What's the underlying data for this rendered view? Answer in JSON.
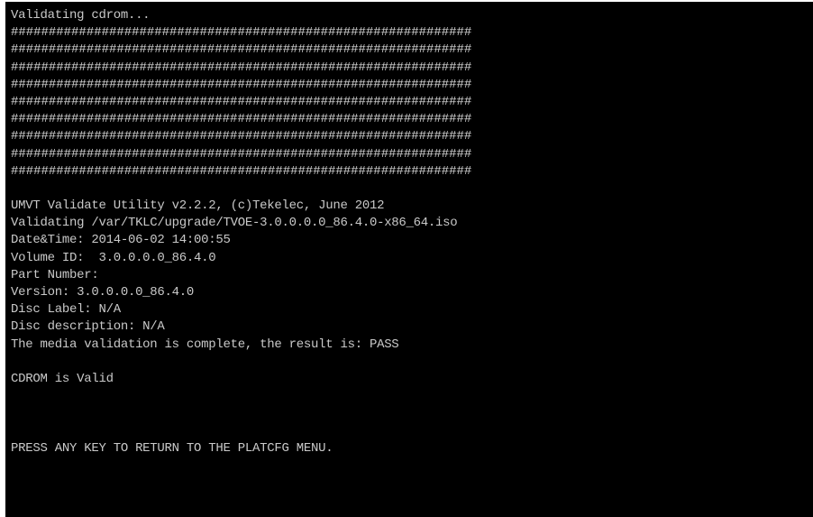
{
  "terminal": {
    "background": "#000000",
    "text_color": "#c9c9c9",
    "header": "Validating cdrom...",
    "progress_rows": [
      "#############################################################",
      "#############################################################",
      "#############################################################",
      "#############################################################",
      "#############################################################",
      "#############################################################",
      "#############################################################",
      "#############################################################",
      "#############################################################"
    ],
    "utility_line": "UMVT Validate Utility v2.2.2, (c)Tekelec, June 2012",
    "validating_line": "Validating /var/TKLC/upgrade/TVOE-3.0.0.0.0_86.4.0-x86_64.iso",
    "datetime_line": "Date&Time: 2014-06-02 14:00:55",
    "volume_id_line": "Volume ID:  3.0.0.0.0_86.4.0",
    "part_number_line": "Part Number:",
    "version_line": "Version: 3.0.0.0.0_86.4.0",
    "disc_label_line": "Disc Label: N/A",
    "disc_description_line": "Disc description: N/A",
    "result_line": "The media validation is complete, the result is: PASS",
    "status_line": "CDROM is Valid",
    "prompt_line": "PRESS ANY KEY TO RETURN TO THE PLATCFG MENU."
  }
}
